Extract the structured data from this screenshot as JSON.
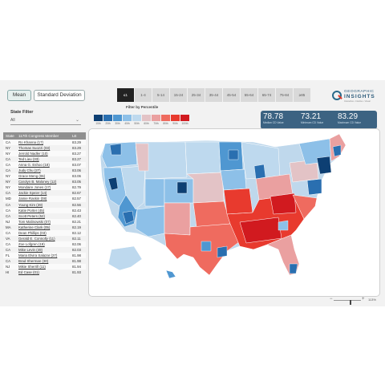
{
  "toggle": {
    "mean_label": "Mean",
    "sd_label": "Standard Deviation"
  },
  "percentile_buttons": [
    "≤1",
    "1-4",
    "5-14",
    "15-24",
    "25-34",
    "35-44",
    "45-54",
    "55-64",
    "65-74",
    "75-84",
    "≥85"
  ],
  "logo": {
    "line1": "GEOGRAPHIC",
    "line2": "INSIGHTS",
    "line3": "Interactive • Intuitive • Visual"
  },
  "state_filter": {
    "label": "State Filter",
    "value": "All"
  },
  "filter_by_percentile_label": "Filter by Percentile",
  "legend": [
    {
      "label": "10th",
      "color": "#0d3f73"
    },
    {
      "label": "20th",
      "color": "#2a6fb0"
    },
    {
      "label": "30th",
      "color": "#4f97d1"
    },
    {
      "label": "40th",
      "color": "#8dc0e8"
    },
    {
      "label": "50th",
      "color": "#bed9ee"
    },
    {
      "label": "60th",
      "color": "#e3c3c6"
    },
    {
      "label": "70th",
      "color": "#eaa0a0"
    },
    {
      "label": "80th",
      "color": "#ef6b5f"
    },
    {
      "label": "90th",
      "color": "#e83a2e"
    },
    {
      "label": "100th",
      "color": "#d11a1f"
    }
  ],
  "stats": [
    {
      "value": "78.78",
      "label": "Median CD Value"
    },
    {
      "value": "73.21",
      "label": "Minimum CD Value"
    },
    {
      "value": "83.29",
      "label": "Maximum CD Value"
    }
  ],
  "table": {
    "headers": [
      "State",
      "117th Congress Member",
      "LE"
    ],
    "rows": [
      [
        "CA",
        "Ro Khanna (17)",
        "83.29"
      ],
      [
        "NY",
        "Thomas Suozzi (03)",
        "83.29"
      ],
      [
        "NY",
        "Jerrold Nadler (10)",
        "83.27"
      ],
      [
        "CA",
        "Ted Lieu (33)",
        "83.27"
      ],
      [
        "CA",
        "Anna G. Eshoo (18)",
        "83.07"
      ],
      [
        "CA",
        "Judy Chu (27)",
        "83.06"
      ],
      [
        "NY",
        "Grace Meng (06)",
        "83.06"
      ],
      [
        "NY",
        "Carolyn B. Maloney (12)",
        "83.05"
      ],
      [
        "NY",
        "Mondaire Jones (17)",
        "82.79"
      ],
      [
        "CA",
        "Jackie Speier (14)",
        "82.67"
      ],
      [
        "MD",
        "Jamie Raskin (08)",
        "82.57"
      ],
      [
        "CA",
        "Young Kim (39)",
        "82.56"
      ],
      [
        "CA",
        "Katie Porter (45)",
        "82.43"
      ],
      [
        "CA",
        "Scott Peters (52)",
        "82.40"
      ],
      [
        "NJ",
        "Tom Malinowski (07)",
        "82.21"
      ],
      [
        "MA",
        "Katherine Clark (05)",
        "82.19"
      ],
      [
        "CA",
        "Dean Phillips (03)",
        "82.12"
      ],
      [
        "VA",
        "Gerald E. Connolly (11)",
        "82.11"
      ],
      [
        "CA",
        "Zoe Lofgren (19)",
        "82.06"
      ],
      [
        "CA",
        "Mike Levin (49)",
        "82.03"
      ],
      [
        "FL",
        "Maria Elvira Salazar (27)",
        "81.98"
      ],
      [
        "CA",
        "Brad Sherman (30)",
        "81.98"
      ],
      [
        "NJ",
        "Mikie Sherrill (11)",
        "81.94"
      ],
      [
        "HI",
        "Ed Case (01)",
        "81.93"
      ]
    ]
  },
  "zoom": {
    "value": "113%"
  }
}
